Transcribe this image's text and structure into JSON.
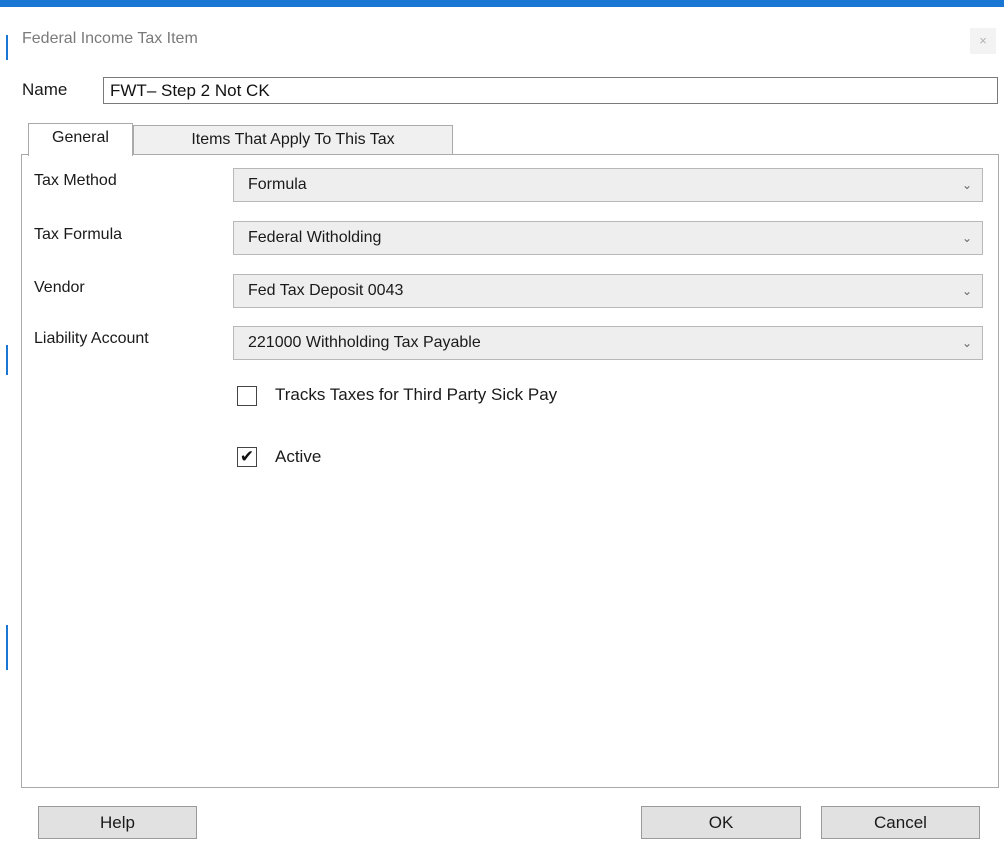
{
  "window": {
    "title": "Federal Income Tax Item",
    "close_glyph": "×"
  },
  "name": {
    "label": "Name",
    "value": "FWT– Step 2 Not CK"
  },
  "tabs": [
    {
      "label": "General",
      "active": true
    },
    {
      "label": "Items That Apply To This Tax",
      "active": false
    }
  ],
  "fields": {
    "tax_method": {
      "label": "Tax Method",
      "value": "Formula"
    },
    "tax_formula": {
      "label": "Tax Formula",
      "value": "Federal Witholding"
    },
    "vendor": {
      "label": "Vendor",
      "value": "Fed Tax Deposit 0043"
    },
    "liability_account": {
      "label": "Liability Account",
      "value": "221000 Withholding Tax Payable"
    }
  },
  "checkboxes": {
    "third_party_sick_pay": {
      "label": "Tracks Taxes for Third Party Sick Pay",
      "checked": false
    },
    "active": {
      "label": "Active",
      "checked": true,
      "mark": "✔"
    }
  },
  "buttons": {
    "help": "Help",
    "ok": "OK",
    "cancel": "Cancel"
  },
  "icons": {
    "dropdown": "chevron-down-icon",
    "close": "close-icon"
  },
  "colors": {
    "accent": "#1976d2",
    "button_bg": "#e1e1e1",
    "select_bg": "#eeeeee"
  }
}
